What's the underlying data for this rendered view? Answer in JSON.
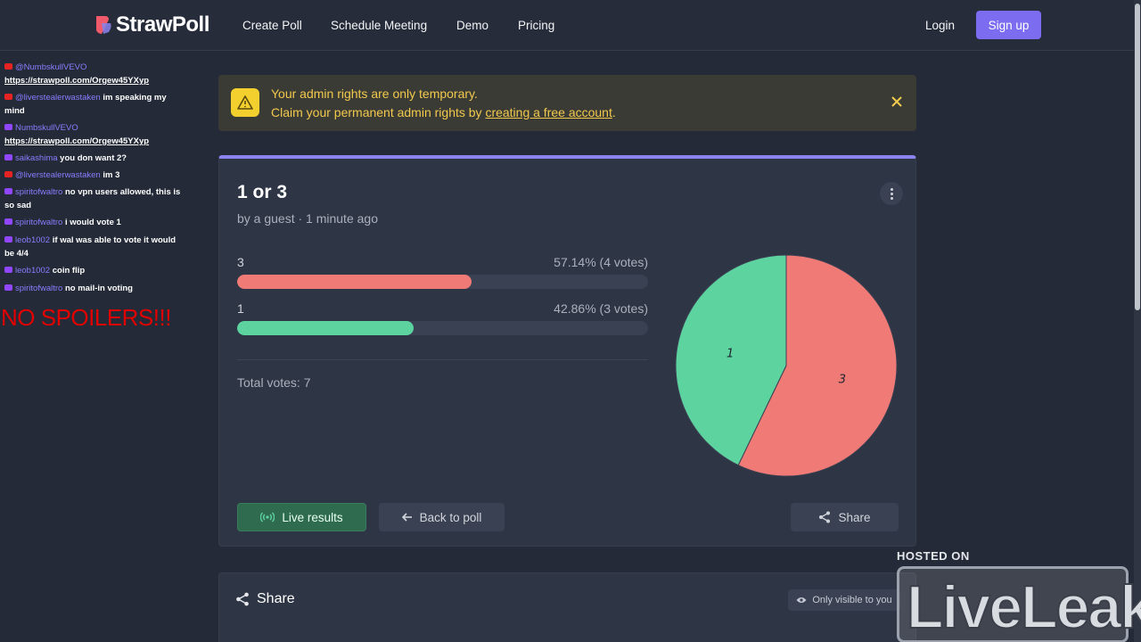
{
  "navbar": {
    "logo_text": "StrawPoll",
    "links": [
      "Create Poll",
      "Schedule Meeting",
      "Demo",
      "Pricing"
    ],
    "login": "Login",
    "signup": "Sign up"
  },
  "chat": {
    "messages": [
      {
        "platform": "youtube",
        "user": "@NumbskullVEVO",
        "text": "https://strawpoll.com/Orgew45YXyp",
        "is_link": true
      },
      {
        "platform": "youtube",
        "user": "@liverstealerwastaken",
        "text": "im speaking my mind",
        "is_link": false
      },
      {
        "platform": "twitch",
        "user": "NumbskullVEVO",
        "text": "https://strawpoll.com/Orgew45YXyp",
        "is_link": true
      },
      {
        "platform": "twitch",
        "user": "saikashima",
        "text": "you don want 2?",
        "is_link": false
      },
      {
        "platform": "youtube",
        "user": "@liverstealerwastaken",
        "text": "im 3",
        "is_link": false
      },
      {
        "platform": "twitch",
        "user": "spiritofwaltro",
        "text": "no vpn users allowed, this is so sad",
        "is_link": false
      },
      {
        "platform": "twitch",
        "user": "spiritofwaltro",
        "text": "i would vote 1",
        "is_link": false
      },
      {
        "platform": "twitch",
        "user": "leob1002",
        "text": "if wal was able to vote it would be 4/4",
        "is_link": false
      },
      {
        "platform": "twitch",
        "user": "leob1002",
        "text": "coin flip",
        "is_link": false
      },
      {
        "platform": "twitch",
        "user": "spiritofwaltro",
        "text": "no mail-in voting",
        "is_link": false
      }
    ],
    "overlay_text": "NO SPOILERS!!!"
  },
  "alert": {
    "line1": "Your admin rights are only temporary.",
    "line2_prefix": "Claim your permanent admin rights by ",
    "line2_link": "creating a free account",
    "line2_suffix": "."
  },
  "poll": {
    "title": "1 or 3",
    "meta": "by a guest · 1 minute ago",
    "options": [
      {
        "label": "3",
        "stat": "57.14% (4 votes)",
        "percent": 57.14,
        "votes": 4,
        "color": "#f07a75"
      },
      {
        "label": "1",
        "stat": "42.86% (3 votes)",
        "percent": 42.86,
        "votes": 3,
        "color": "#5dd4a0"
      }
    ],
    "total": "Total votes: 7",
    "buttons": {
      "live": "Live results",
      "back": "Back to poll",
      "share": "Share"
    }
  },
  "share_section": {
    "title": "Share",
    "visibility": "Only visible to you"
  },
  "watermark": {
    "hosted_on": "HOSTED ON",
    "brand": "LiveLeak"
  },
  "colors": {
    "accent": "#7c6cf0",
    "option_3": "#f07a75",
    "option_1": "#5dd4a0",
    "alert_text": "#f2c94c"
  }
}
